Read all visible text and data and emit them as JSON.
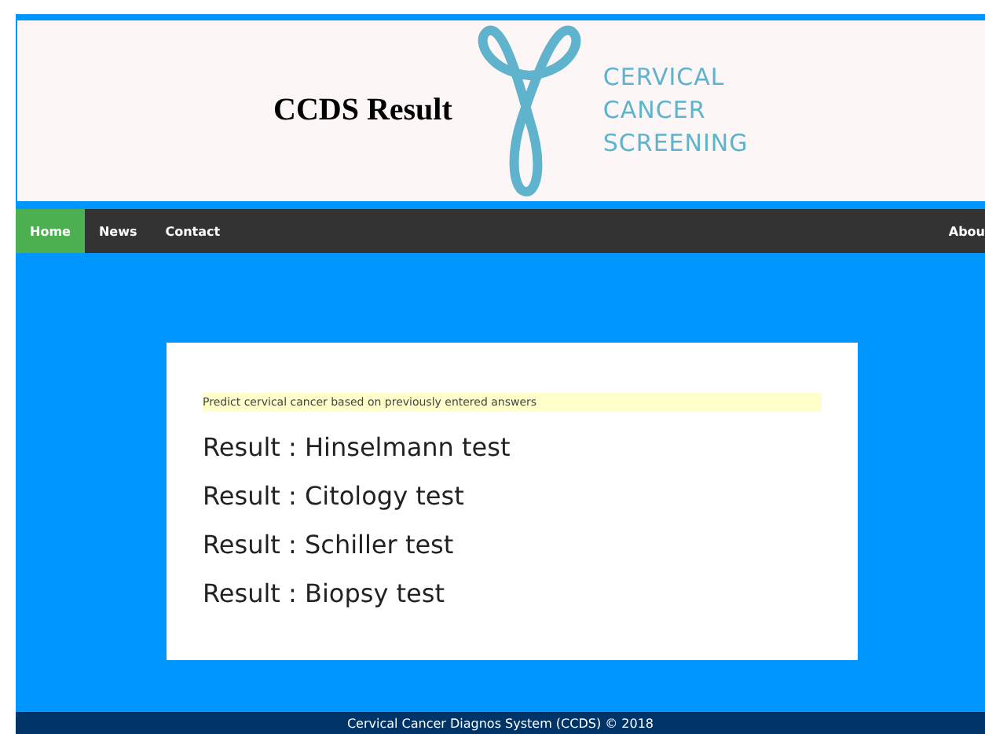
{
  "header": {
    "title": "CCDS Result",
    "logo_text": [
      "CERVICAL",
      "CANCER",
      "SCREENING"
    ]
  },
  "nav": {
    "items": [
      {
        "label": "Home",
        "selected": true
      },
      {
        "label": "News",
        "selected": false
      },
      {
        "label": "Contact",
        "selected": false
      }
    ],
    "right_item": "Abou"
  },
  "card": {
    "note": "Predict cervical cancer based on previously entered answers",
    "results": [
      "Result : Hinselmann test",
      "Result : Citology test",
      "Result : Schiller test",
      "Result : Biopsy test"
    ]
  },
  "footer": "Cervical Cancer Diagnos System (CCDS) © 2018"
}
